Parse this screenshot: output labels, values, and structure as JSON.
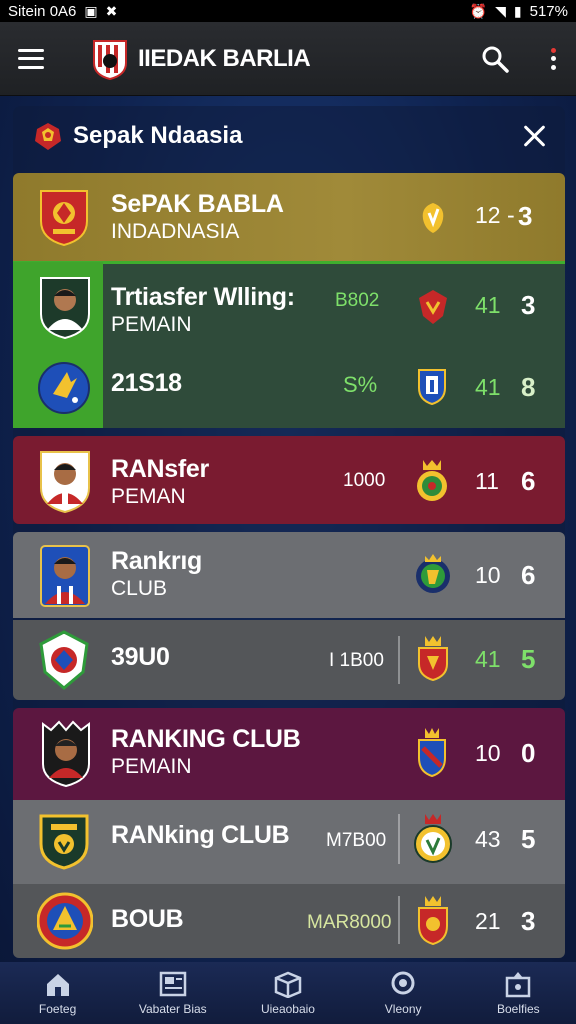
{
  "status_bar": {
    "left_text": "Sitein 0A6",
    "battery": "517%"
  },
  "app_bar": {
    "title": "IIEDAK BARLIA",
    "menu_icon": "hamburger-menu-icon",
    "search_icon": "search-icon",
    "more_icon": "more-vert-icon"
  },
  "panel": {
    "title": "Sepak Ndaasia"
  },
  "rows": [
    {
      "line1": "SePAK BABLA",
      "line2": "INDADNASIA",
      "extra": "",
      "score1": "12 -",
      "score2": "3"
    },
    {
      "line1": "Trtiasfer Wlling:",
      "line2": "PEMAIN",
      "extra": "B802",
      "score1": "41",
      "score2": "3"
    },
    {
      "line1": "21S18",
      "line2": "",
      "extra": "S%",
      "score1": "41",
      "score2": "8"
    },
    {
      "line1": "RANsfer",
      "line2": "PEMAN",
      "extra": "1000",
      "score1": "11",
      "score2": "6"
    },
    {
      "line1": "Rankrıg",
      "line2": "CLUB",
      "extra": "",
      "score1": "10",
      "score2": "6"
    },
    {
      "line1": "39U0",
      "line2": "",
      "extra": "I 1B00",
      "score1": "41",
      "score2": "5"
    },
    {
      "line1": "RANKING CLUB",
      "line2": "PEMAIN",
      "extra": "",
      "score1": "10",
      "score2": "0"
    },
    {
      "line1": "RANking CLUB",
      "line2": "",
      "extra": "M7B00",
      "score1": "43",
      "score2": "5"
    },
    {
      "line1": "BOUB",
      "line2": "",
      "extra": "MAR8000",
      "score1": "21",
      "score2": "3"
    }
  ],
  "bottom_nav": [
    {
      "label": "Foeteg",
      "icon": "home-icon"
    },
    {
      "label": "Vabater Bias",
      "icon": "news-icon"
    },
    {
      "label": "Uieaobaio",
      "icon": "box-icon"
    },
    {
      "label": "Vleony",
      "icon": "search-circle-icon"
    },
    {
      "label": "Boelfies",
      "icon": "store-icon"
    }
  ],
  "colors": {
    "background": "#0f2350",
    "app_bar": "#23252a",
    "gold_row": "#9a8535",
    "green_accent": "#3fa42c",
    "maroon_row": "#7a1b30",
    "grey_row": "#6c6e72",
    "purple_row": "#5c1740",
    "score_green": "#7ee06a"
  }
}
